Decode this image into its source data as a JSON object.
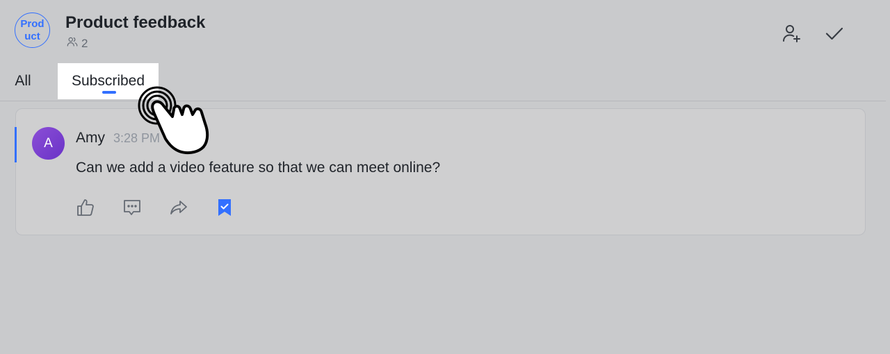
{
  "header": {
    "avatar_text": "Prod\nuct",
    "title": "Product feedback",
    "member_count": "2",
    "icons": {
      "members": "members-icon",
      "add_member": "add-member-icon",
      "done": "check-icon"
    }
  },
  "tabs": [
    {
      "label": "All",
      "selected": false
    },
    {
      "label": "Subscribed",
      "selected": true
    }
  ],
  "message": {
    "avatar_initial": "A",
    "sender": "Amy",
    "time": "3:28 PM",
    "text": "Can we add a video feature so that we can meet online?",
    "actions": [
      "thumbs-up-icon",
      "comment-icon",
      "forward-icon",
      "bookmark-icon"
    ],
    "bookmarked": true
  },
  "colors": {
    "accent": "#3370ff",
    "avatar_purple": "#7b3fd0",
    "background": "#c9cacc"
  }
}
